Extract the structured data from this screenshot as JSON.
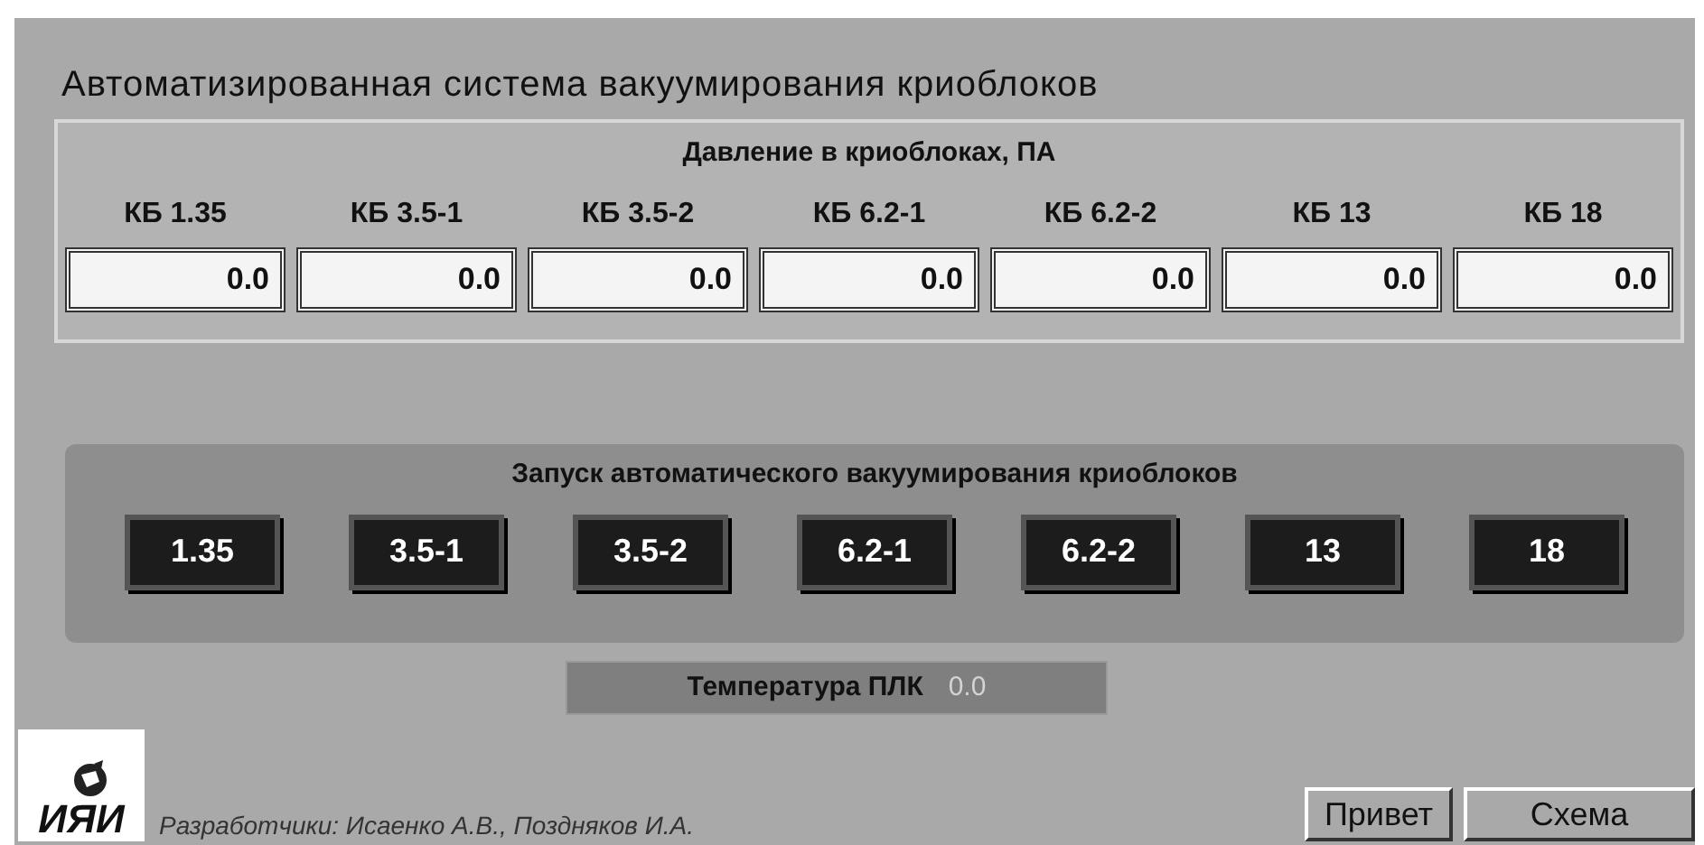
{
  "title": "Автоматизированная система вакуумирования криоблоков",
  "pressure": {
    "heading": "Давление в криоблоках, ПА",
    "blocks": [
      {
        "label": "КБ 1.35",
        "value": "0.0"
      },
      {
        "label": "КБ 3.5-1",
        "value": "0.0"
      },
      {
        "label": "КБ 3.5-2",
        "value": "0.0"
      },
      {
        "label": "КБ 6.2-1",
        "value": "0.0"
      },
      {
        "label": "КБ 6.2-2",
        "value": "0.0"
      },
      {
        "label": "КБ 13",
        "value": "0.0"
      },
      {
        "label": "КБ 18",
        "value": "0.0"
      }
    ]
  },
  "launch": {
    "heading": "Запуск автоматического вакуумирования криоблоков",
    "buttons": [
      "1.35",
      "3.5-1",
      "3.5-2",
      "6.2-1",
      "6.2-2",
      "13",
      "18"
    ]
  },
  "plc_temperature": {
    "label": "Температура ПЛК",
    "value": "0.0"
  },
  "logo": {
    "text": "ИЯИ"
  },
  "developers": "Разработчики: Исаенко А.В., Поздняков И.А.",
  "buttons": [
    "Привет",
    "Схема"
  ]
}
